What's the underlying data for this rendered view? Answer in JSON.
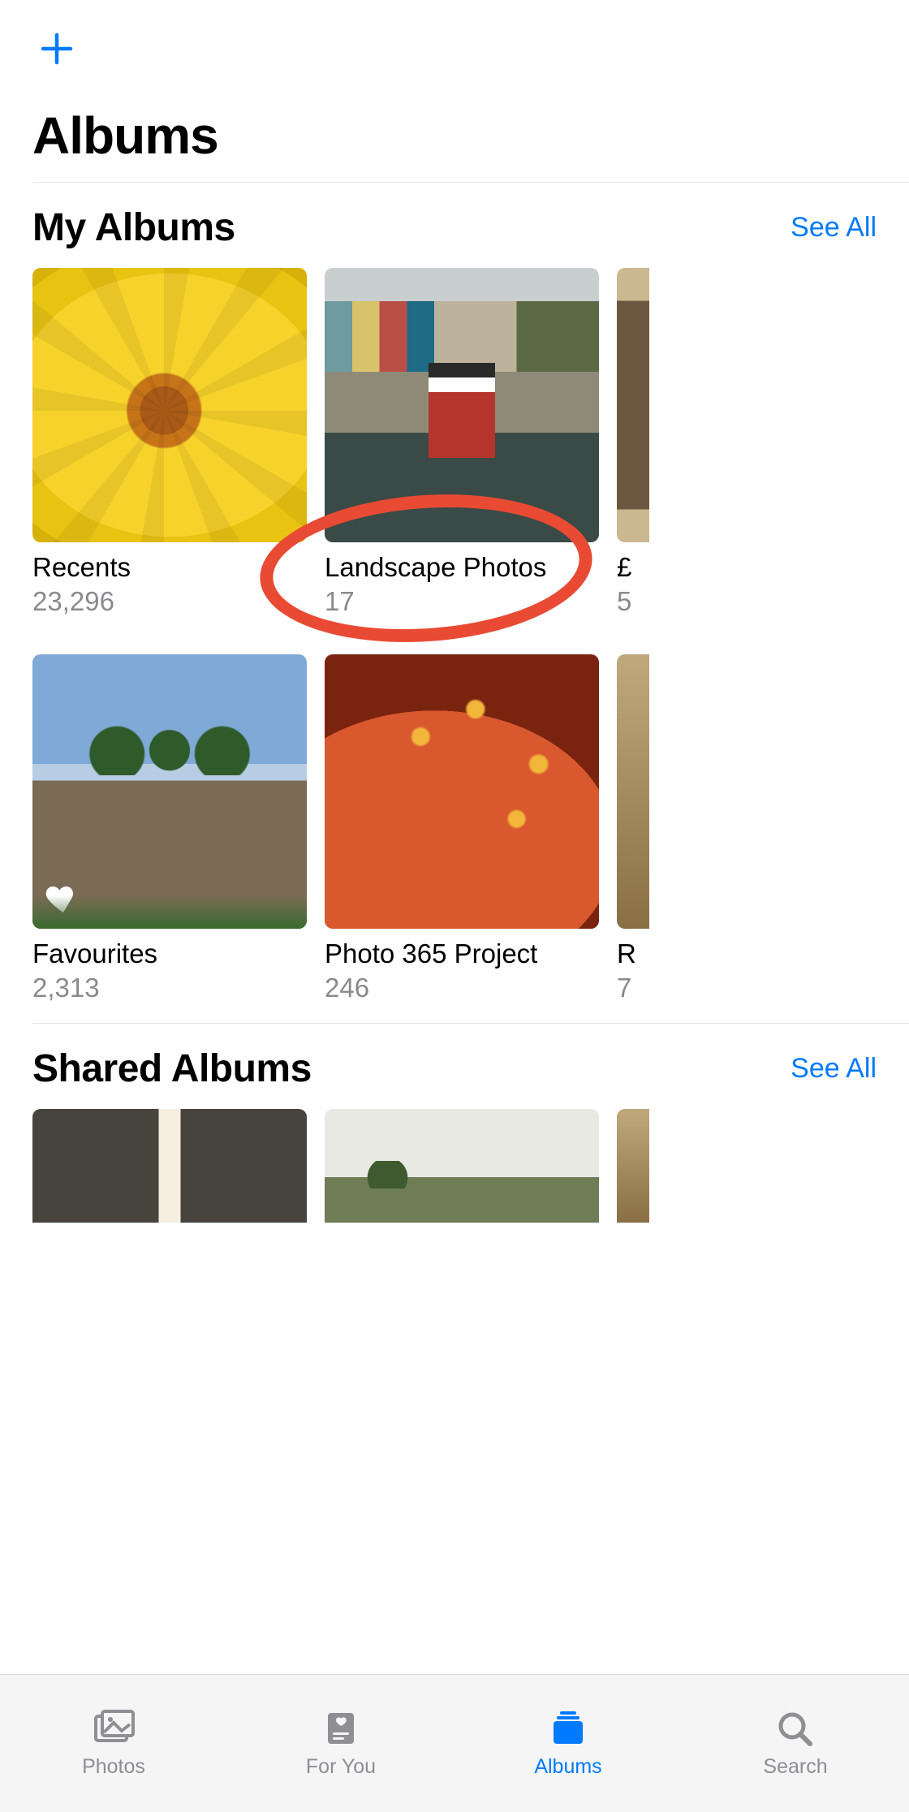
{
  "header": {
    "add_label": "Add"
  },
  "page_title": "Albums",
  "sections": {
    "my_albums": {
      "title": "My Albums",
      "see_all": "See All",
      "items": [
        {
          "name": "Recents",
          "count": "23,296"
        },
        {
          "name": "Landscape Photos",
          "count": "17"
        },
        {
          "name": "£",
          "count": "5"
        },
        {
          "name": "Favourites",
          "count": "2,313"
        },
        {
          "name": "Photo 365 Project",
          "count": "246"
        },
        {
          "name": "R",
          "count": "7"
        }
      ]
    },
    "shared_albums": {
      "title": "Shared Albums",
      "see_all": "See All"
    }
  },
  "tabs": {
    "photos": "Photos",
    "for_you": "For You",
    "albums": "Albums",
    "search": "Search",
    "active": "albums"
  },
  "colors": {
    "accent": "#007aff",
    "annotation": "#e94a33",
    "muted": "#8a8a8e"
  }
}
